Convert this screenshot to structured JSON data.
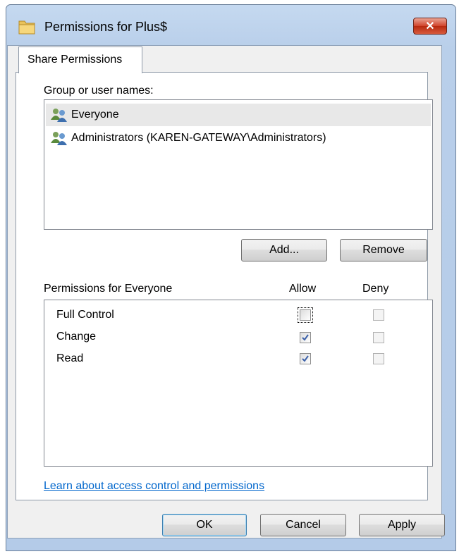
{
  "window": {
    "title": "Permissions for Plus$",
    "close_label": "✕"
  },
  "tabs": [
    {
      "label": "Share Permissions",
      "active": true
    }
  ],
  "group_section": {
    "label": "Group or user names:",
    "items": [
      {
        "name": "Everyone",
        "icon": "users-icon",
        "selected": true
      },
      {
        "name": "Administrators (KAREN-GATEWAY\\Administrators)",
        "icon": "users-icon",
        "selected": false
      }
    ],
    "add_label": "Add...",
    "remove_label": "Remove"
  },
  "permissions": {
    "header": "Permissions for Everyone",
    "allow_header": "Allow",
    "deny_header": "Deny",
    "rows": [
      {
        "name": "Full Control",
        "allow": false,
        "deny": false
      },
      {
        "name": "Change",
        "allow": true,
        "deny": false
      },
      {
        "name": "Read",
        "allow": true,
        "deny": false
      }
    ]
  },
  "help_link": "Learn about access control and permissions",
  "footer": {
    "ok_label": "OK",
    "cancel_label": "Cancel",
    "apply_label": "Apply"
  },
  "colors": {
    "titlebar": "#b9cfea",
    "close_button": "#d1432b",
    "link": "#0066cc",
    "selection": "#e8e8e8"
  }
}
